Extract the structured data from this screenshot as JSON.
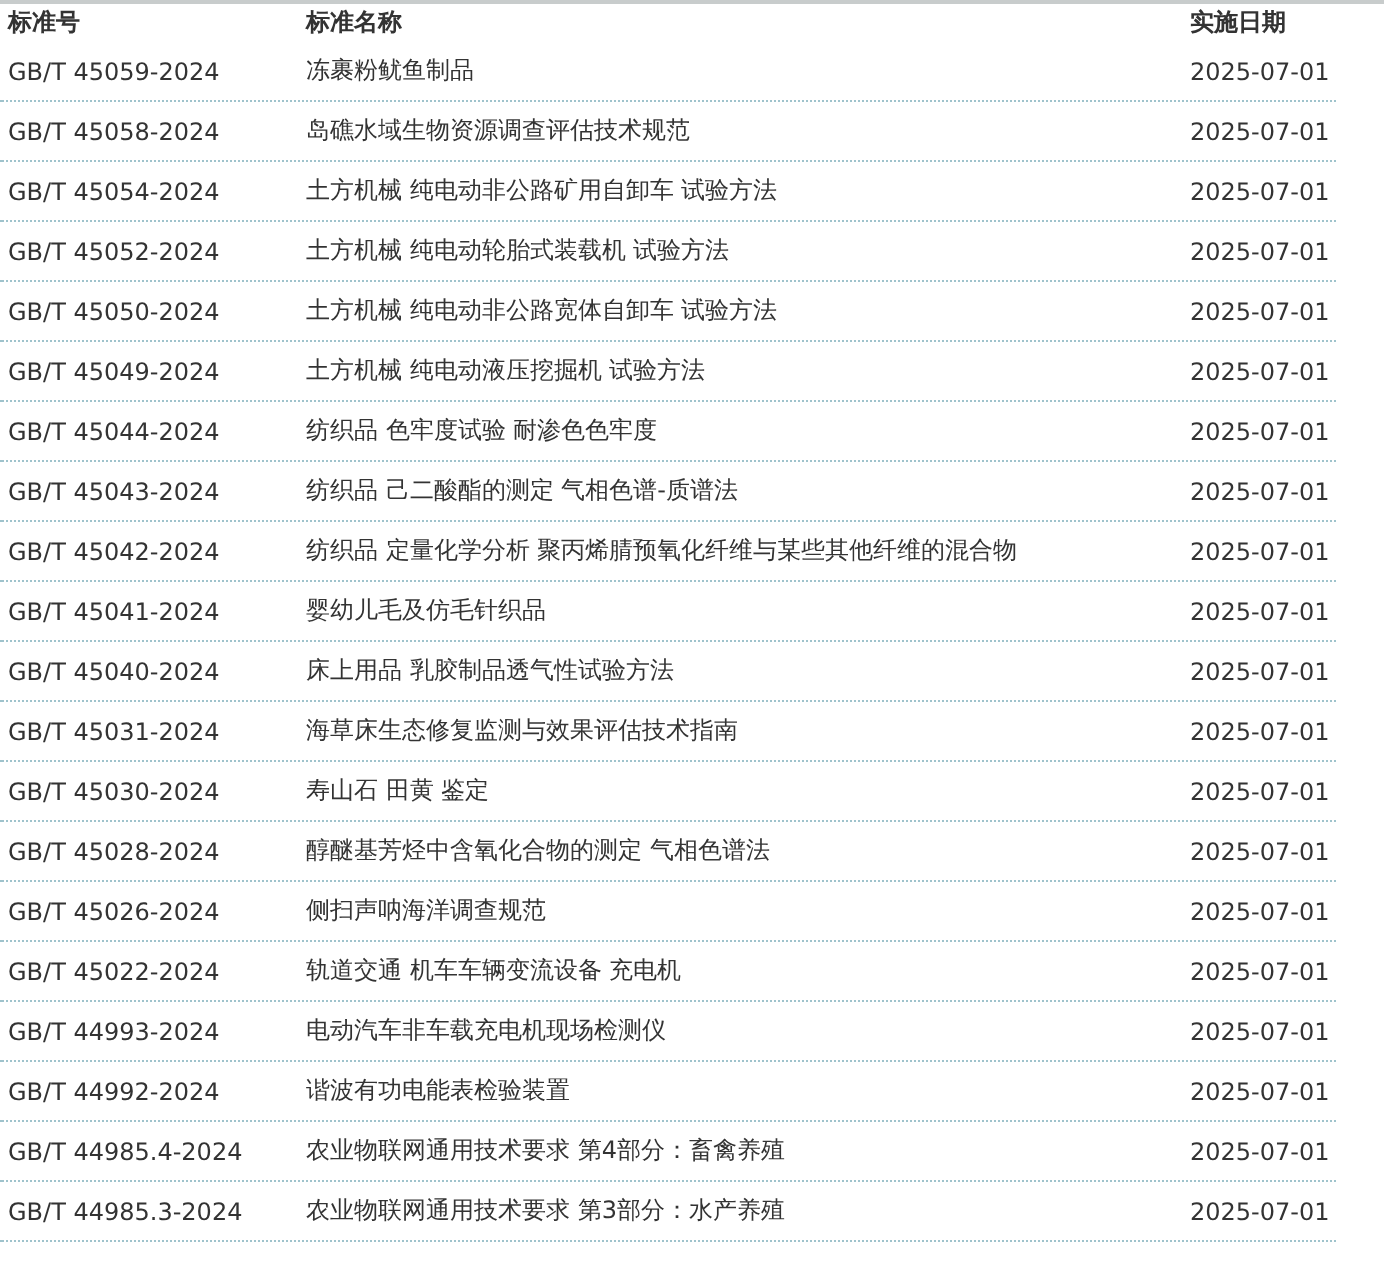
{
  "table": {
    "columns": [
      "标准号",
      "标准名称",
      "实施日期"
    ],
    "rows": [
      {
        "number": "GB/T 45059-2024",
        "name": "冻裹粉鱿鱼制品",
        "date": "2025-07-01"
      },
      {
        "number": "GB/T 45058-2024",
        "name": "岛礁水域生物资源调查评估技术规范",
        "date": "2025-07-01"
      },
      {
        "number": "GB/T 45054-2024",
        "name": "土方机械 纯电动非公路矿用自卸车 试验方法",
        "date": "2025-07-01"
      },
      {
        "number": "GB/T 45052-2024",
        "name": "土方机械 纯电动轮胎式装载机 试验方法",
        "date": "2025-07-01"
      },
      {
        "number": "GB/T 45050-2024",
        "name": "土方机械 纯电动非公路宽体自卸车 试验方法",
        "date": "2025-07-01"
      },
      {
        "number": "GB/T 45049-2024",
        "name": "土方机械 纯电动液压挖掘机 试验方法",
        "date": "2025-07-01"
      },
      {
        "number": "GB/T 45044-2024",
        "name": "纺织品 色牢度试验 耐渗色色牢度",
        "date": "2025-07-01"
      },
      {
        "number": "GB/T 45043-2024",
        "name": "纺织品 己二酸酯的测定 气相色谱-质谱法",
        "date": "2025-07-01"
      },
      {
        "number": "GB/T 45042-2024",
        "name": "纺织品 定量化学分析 聚丙烯腈预氧化纤维与某些其他纤维的混合物",
        "date": "2025-07-01"
      },
      {
        "number": "GB/T 45041-2024",
        "name": "婴幼儿毛及仿毛针织品",
        "date": "2025-07-01"
      },
      {
        "number": "GB/T 45040-2024",
        "name": "床上用品 乳胶制品透气性试验方法",
        "date": "2025-07-01"
      },
      {
        "number": "GB/T 45031-2024",
        "name": "海草床生态修复监测与效果评估技术指南",
        "date": "2025-07-01"
      },
      {
        "number": "GB/T 45030-2024",
        "name": "寿山石 田黄 鉴定",
        "date": "2025-07-01"
      },
      {
        "number": "GB/T 45028-2024",
        "name": "醇醚基芳烃中含氧化合物的测定 气相色谱法",
        "date": "2025-07-01"
      },
      {
        "number": "GB/T 45026-2024",
        "name": "侧扫声呐海洋调查规范",
        "date": "2025-07-01"
      },
      {
        "number": "GB/T 45022-2024",
        "name": "轨道交通 机车车辆变流设备 充电机",
        "date": "2025-07-01"
      },
      {
        "number": "GB/T 44993-2024",
        "name": "电动汽车非车载充电机现场检测仪",
        "date": "2025-07-01"
      },
      {
        "number": "GB/T 44992-2024",
        "name": "谐波有功电能表检验装置",
        "date": "2025-07-01"
      },
      {
        "number": "GB/T 44985.4-2024",
        "name": "农业物联网通用技术要求 第4部分：畜禽养殖",
        "date": "2025-07-01"
      },
      {
        "number": "GB/T 44985.3-2024",
        "name": "农业物联网通用技术要求 第3部分：水产养殖",
        "date": "2025-07-01"
      }
    ]
  }
}
